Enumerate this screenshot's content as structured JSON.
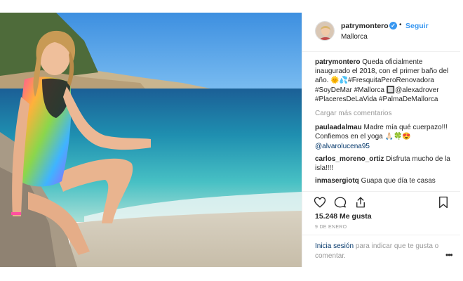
{
  "post": {
    "username": "patrymontero",
    "follow_label": "Seguir",
    "separator": "•",
    "location": "Mallorca",
    "verified_badge": "check",
    "caption_text": "Queda oficialmente inaugurado el 2018, con el primer baño del año. 🌞💦#FresquitaPeroRenovadora #SoyDeMar #Mallorca 🔲@alexadrover #PlaceresDeLaVida #PalmaDeMallorca",
    "load_more_label": "Cargar más comentarios",
    "comments": [
      {
        "user": "paulaadalmau",
        "text": "Madre mía qué cuerpazo!!! Confiemos en el yoga 🙏🏻🍀😍",
        "mention": "@alvarolucena95"
      },
      {
        "user": "carlos_moreno_ortiz",
        "text": "Disfruta mucho de la isla!!!!",
        "mention": ""
      },
      {
        "user": "inmasergiotq",
        "text": "Guapa que día te casas",
        "mention": ""
      }
    ],
    "likes_label": "15.248 Me gusta",
    "date_label": "9 DE ENERO",
    "login_link": "Inicia sesión",
    "login_rest": "para indicar que te gusta o comentar.",
    "more_options": "•••",
    "icons": {
      "like": "heart-icon",
      "comment": "comment-icon",
      "share": "share-icon",
      "save": "bookmark-icon",
      "more": "more-options-icon"
    },
    "colors": {
      "link_blue": "#3897f0",
      "hashtag_blue": "#003569",
      "muted_gray": "#999999",
      "text": "#262626"
    }
  }
}
